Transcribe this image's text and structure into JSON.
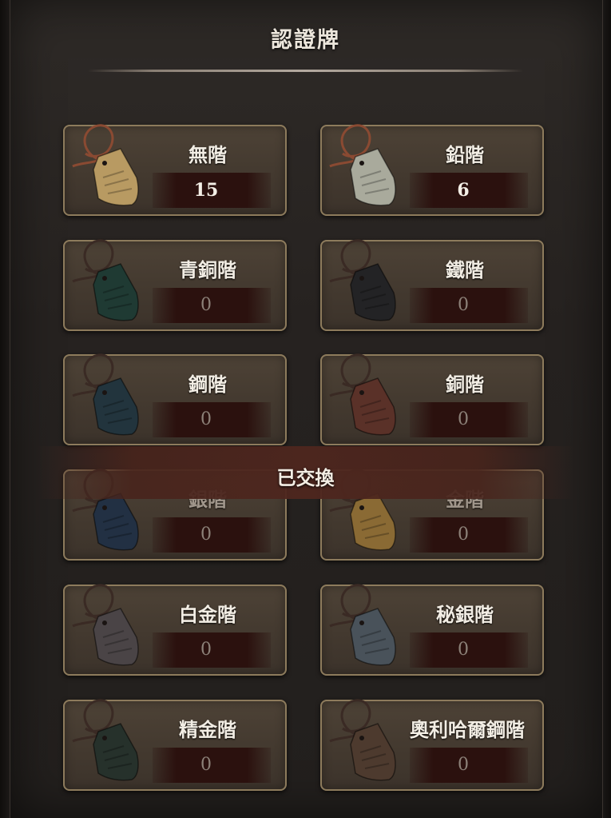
{
  "header": {
    "title": "認證牌"
  },
  "overlay": {
    "exchanged_label": "已交換"
  },
  "colors": {
    "card_border": "#8d7b5c",
    "card_bg": "#43392f",
    "count_bg": "#2b110e",
    "banner_bg": "#4e261e"
  },
  "plates": [
    {
      "label": "無階",
      "count": "15",
      "icon": "plate-tag-icon",
      "color": "#b89a62"
    },
    {
      "label": "鉛階",
      "count": "6",
      "icon": "plate-tag-icon",
      "color": "#a9aa9c"
    },
    {
      "label": "青銅階",
      "count": "0",
      "icon": "plate-tag-icon",
      "color": "#1f3a33"
    },
    {
      "label": "鐵階",
      "count": "0",
      "icon": "plate-tag-icon",
      "color": "#232325"
    },
    {
      "label": "鋼階",
      "count": "0",
      "icon": "plate-tag-icon",
      "color": "#22343d"
    },
    {
      "label": "銅階",
      "count": "0",
      "icon": "plate-tag-icon",
      "color": "#5a3128"
    },
    {
      "label": "銀階",
      "count": "0",
      "icon": "plate-tag-icon",
      "color": "#223043"
    },
    {
      "label": "金階",
      "count": "0",
      "icon": "plate-tag-icon",
      "color": "#8a6a34"
    },
    {
      "label": "白金階",
      "count": "0",
      "icon": "plate-tag-icon",
      "color": "#4a4446"
    },
    {
      "label": "秘銀階",
      "count": "0",
      "icon": "plate-tag-icon",
      "color": "#49525a"
    },
    {
      "label": "精金階",
      "count": "0",
      "icon": "plate-tag-icon",
      "color": "#26312b"
    },
    {
      "label": "奧利哈爾鋼階",
      "count": "0",
      "icon": "plate-tag-icon",
      "color": "#4d3a2e"
    }
  ]
}
